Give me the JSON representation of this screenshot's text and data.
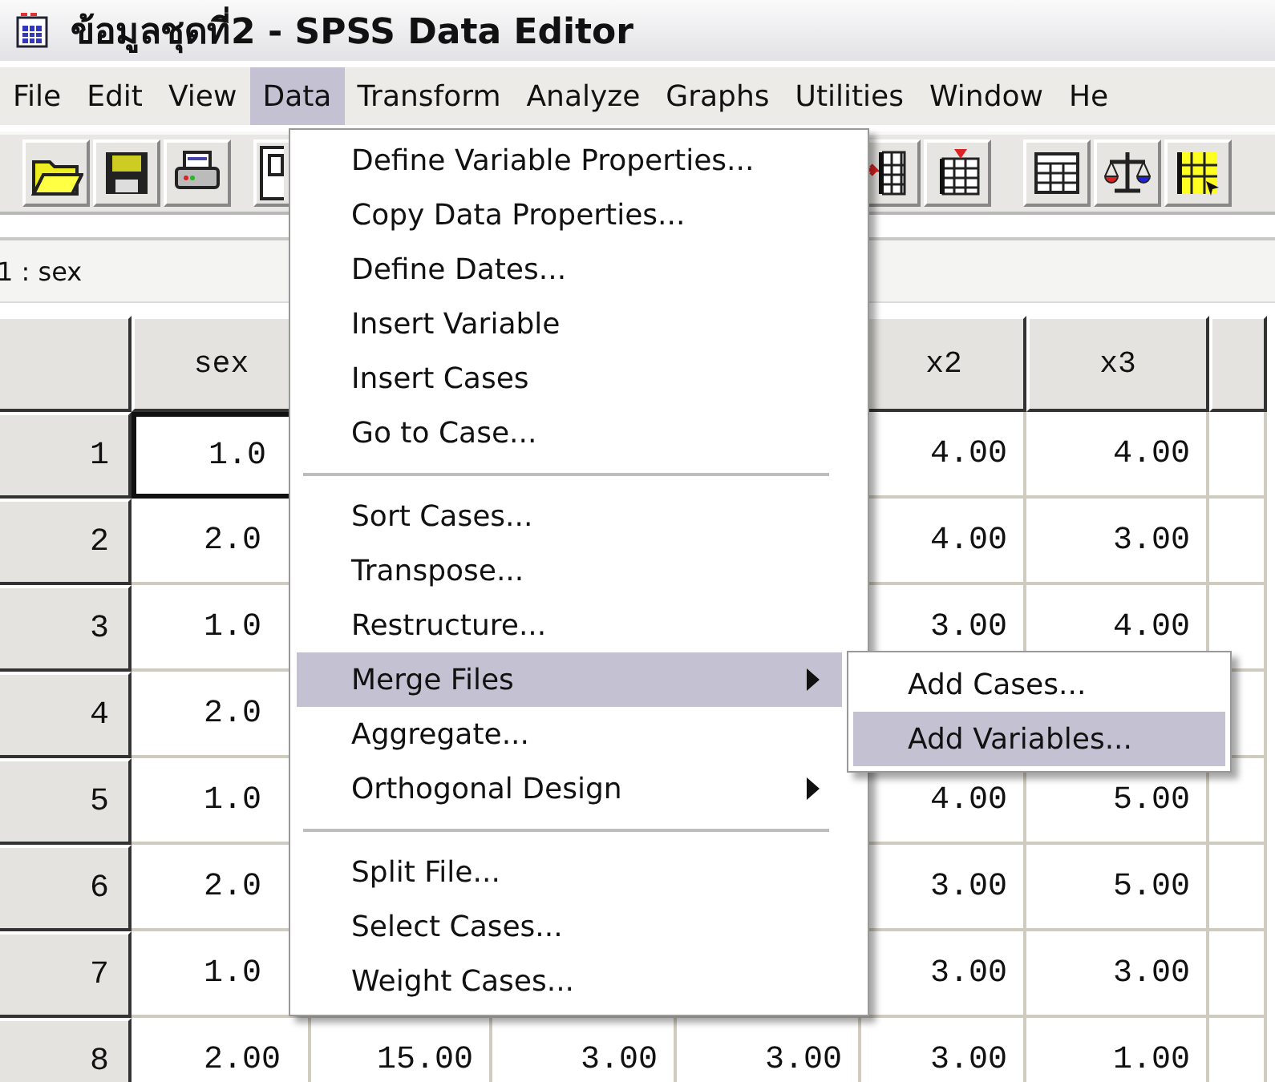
{
  "window": {
    "title": "ข้อมูลชุดที่2 - SPSS Data Editor"
  },
  "menu_bar": [
    {
      "label": "File",
      "selected": false
    },
    {
      "label": "Edit",
      "selected": false
    },
    {
      "label": "View",
      "selected": false
    },
    {
      "label": "Data",
      "selected": true
    },
    {
      "label": "Transform",
      "selected": false
    },
    {
      "label": "Analyze",
      "selected": false
    },
    {
      "label": "Graphs",
      "selected": false
    },
    {
      "label": "Utilities",
      "selected": false
    },
    {
      "label": "Window",
      "selected": false
    },
    {
      "label": "He",
      "selected": false
    }
  ],
  "cell_reference": "1 : sex",
  "table": {
    "columns": [
      "sex",
      null,
      null,
      null,
      "x2",
      "x3",
      null
    ],
    "rows": [
      {
        "number": "1",
        "active": true,
        "cells": [
          "1.0",
          null,
          null,
          null,
          "4.00",
          "4.00",
          null
        ]
      },
      {
        "number": "2",
        "active": false,
        "cells": [
          "2.0",
          null,
          null,
          null,
          "4.00",
          "3.00",
          null
        ]
      },
      {
        "number": "3",
        "active": false,
        "cells": [
          "1.0",
          null,
          null,
          null,
          "3.00",
          "4.00",
          null
        ]
      },
      {
        "number": "4",
        "active": false,
        "cells": [
          "2.0",
          null,
          null,
          null,
          null,
          null,
          null
        ]
      },
      {
        "number": "5",
        "active": false,
        "cells": [
          "1.0",
          null,
          null,
          null,
          "4.00",
          "5.00",
          null
        ]
      },
      {
        "number": "6",
        "active": false,
        "cells": [
          "2.0",
          null,
          null,
          null,
          "3.00",
          "5.00",
          null
        ]
      },
      {
        "number": "7",
        "active": false,
        "cells": [
          "1.0",
          null,
          null,
          null,
          "3.00",
          "3.00",
          null
        ]
      },
      {
        "number": "8",
        "active": false,
        "cells": [
          "2.00",
          "15.00",
          "3.00",
          "3.00",
          "3.00",
          "1.00",
          null
        ]
      }
    ]
  },
  "data_menu": {
    "items": [
      {
        "kind": "item",
        "label": "Define Variable Properties...",
        "submenu": false,
        "selected": false
      },
      {
        "kind": "item",
        "label": "Copy Data Properties...",
        "submenu": false,
        "selected": false
      },
      {
        "kind": "item",
        "label": "Define Dates...",
        "submenu": false,
        "selected": false
      },
      {
        "kind": "item",
        "label": "Insert Variable",
        "submenu": false,
        "selected": false
      },
      {
        "kind": "item",
        "label": "Insert Cases",
        "submenu": false,
        "selected": false
      },
      {
        "kind": "item",
        "label": "Go to Case...",
        "submenu": false,
        "selected": false
      },
      {
        "kind": "separator"
      },
      {
        "kind": "item",
        "label": "Sort Cases...",
        "submenu": false,
        "selected": false
      },
      {
        "kind": "item",
        "label": "Transpose...",
        "submenu": false,
        "selected": false
      },
      {
        "kind": "item",
        "label": "Restructure...",
        "submenu": false,
        "selected": false
      },
      {
        "kind": "item",
        "label": "Merge Files",
        "submenu": true,
        "selected": true
      },
      {
        "kind": "item",
        "label": "Aggregate...",
        "submenu": false,
        "selected": false
      },
      {
        "kind": "item",
        "label": "Orthogonal Design",
        "submenu": true,
        "selected": false
      },
      {
        "kind": "separator"
      },
      {
        "kind": "item",
        "label": "Split File...",
        "submenu": false,
        "selected": false
      },
      {
        "kind": "item",
        "label": "Select Cases...",
        "submenu": false,
        "selected": false
      },
      {
        "kind": "item",
        "label": "Weight Cases...",
        "submenu": false,
        "selected": false
      }
    ]
  },
  "submenu": {
    "items": [
      {
        "label": "Add Cases...",
        "selected": false
      },
      {
        "label": "Add Variables...",
        "selected": true
      }
    ]
  }
}
